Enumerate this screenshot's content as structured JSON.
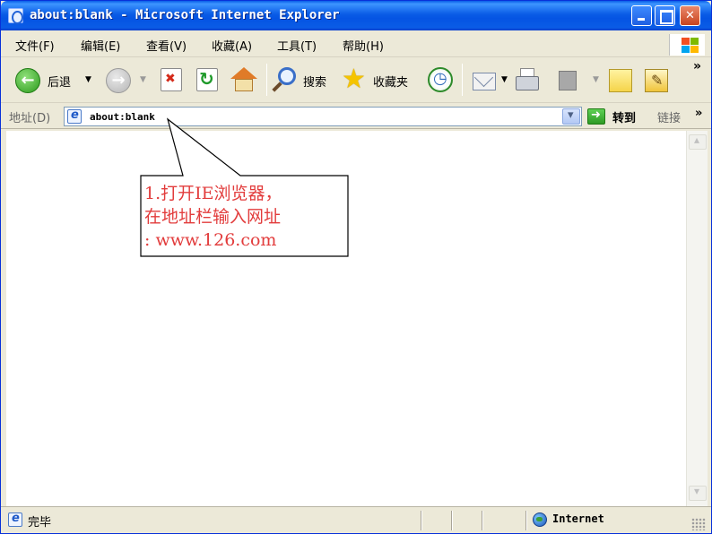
{
  "window": {
    "title": "about:blank - Microsoft Internet Explorer"
  },
  "menu": {
    "items": [
      "文件(F)",
      "编辑(E)",
      "查看(V)",
      "收藏(A)",
      "工具(T)",
      "帮助(H)"
    ]
  },
  "toolbar": {
    "back_label": "后退",
    "search_label": "搜索",
    "favorites_label": "收藏夹",
    "overflow": "»"
  },
  "address": {
    "label": "地址(D)",
    "value": "about:blank",
    "go_label": "转到",
    "links_label": "链接",
    "links_overflow": "»"
  },
  "annotation": {
    "text": "1.打开IE浏览器，\n在地址栏输入网址\n: www.126.com",
    "color": "#e23c3c"
  },
  "status": {
    "text": "完毕",
    "zone": "Internet"
  },
  "colors": {
    "titlebar": "#0a5ce6",
    "chrome": "#ece9d8"
  }
}
